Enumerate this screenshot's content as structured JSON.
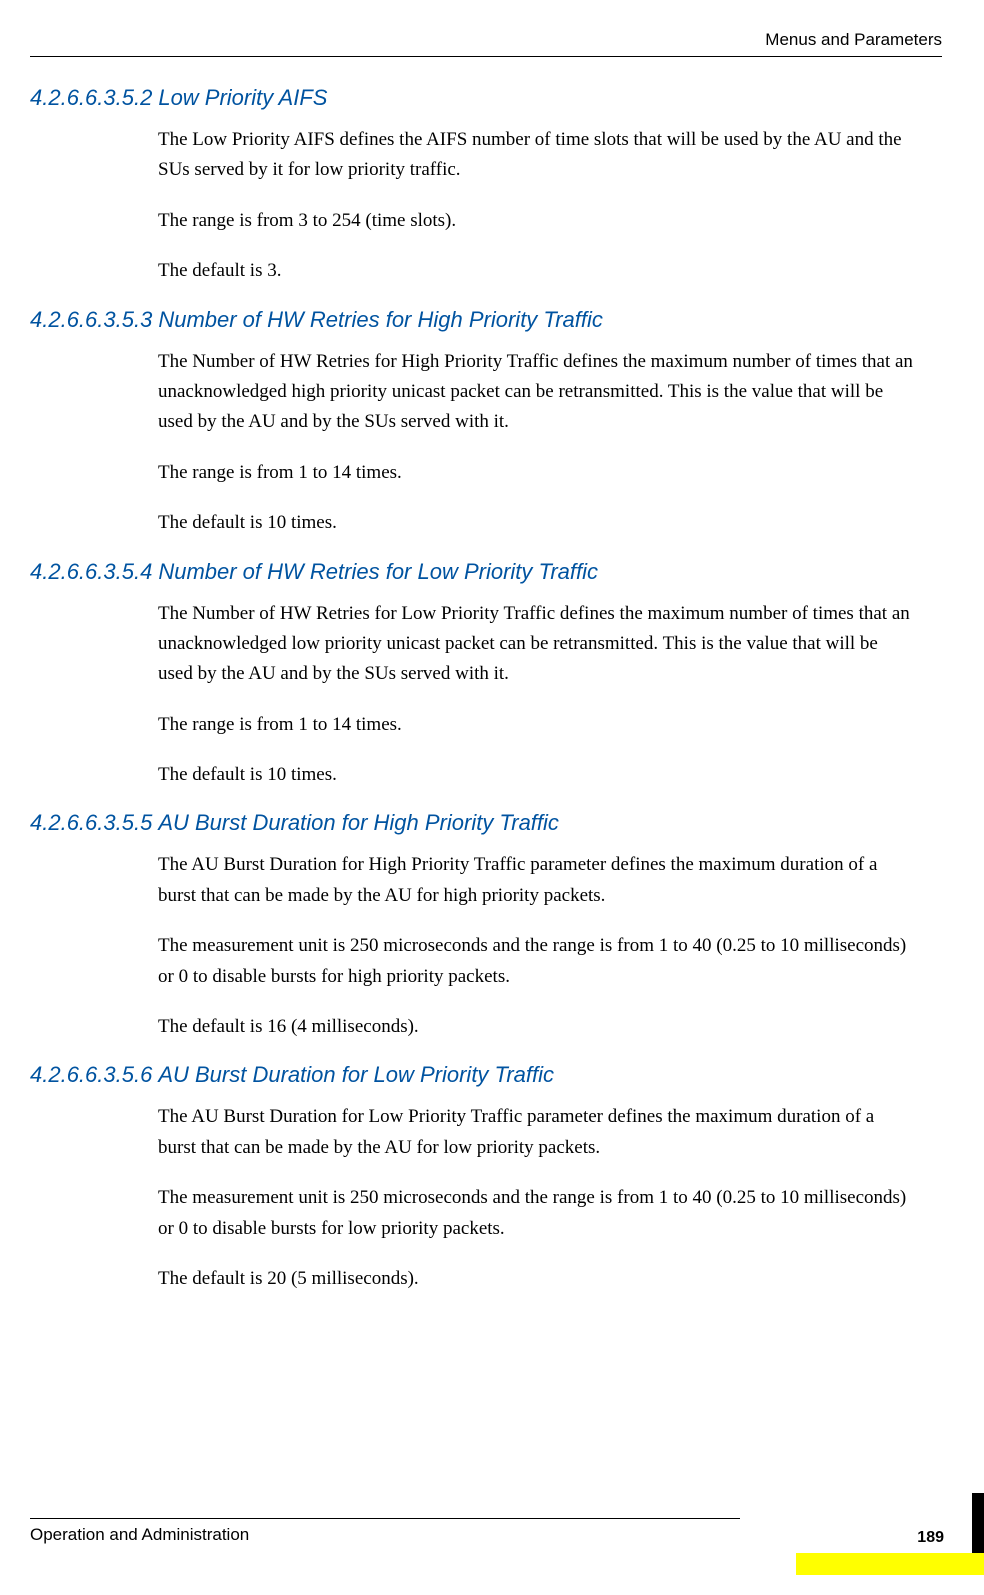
{
  "header": {
    "chapter": "Menus and Parameters"
  },
  "sections": [
    {
      "number": "4.2.6.6.3.5.2",
      "title": "Low Priority AIFS",
      "paragraphs": [
        "The Low Priority AIFS defines the AIFS number of time slots that will be used by the AU and the SUs served by it for low priority traffic.",
        "The range is from 3 to 254 (time slots).",
        "The default is 3."
      ]
    },
    {
      "number": "4.2.6.6.3.5.3",
      "title": "Number of HW Retries for High Priority Traffic",
      "paragraphs": [
        "The Number of HW Retries for High Priority Traffic defines the maximum number of times that an unacknowledged high priority unicast packet can be retransmitted. This is the value that will be used by the AU and by the SUs served with it.",
        "The range is from 1 to 14 times.",
        "The default is 10 times."
      ]
    },
    {
      "number": "4.2.6.6.3.5.4",
      "title": "Number of HW Retries for Low Priority Traffic",
      "paragraphs": [
        "The Number of HW Retries for Low Priority Traffic defines the maximum number of times that an unacknowledged low priority unicast packet can be retransmitted. This is the value that will be used by the AU and by the SUs served with it.",
        "The range is from 1 to 14 times.",
        "The default is 10 times."
      ]
    },
    {
      "number": "4.2.6.6.3.5.5",
      "title": "AU Burst Duration for High Priority Traffic",
      "paragraphs": [
        "The AU Burst Duration for High Priority Traffic parameter defines the maximum duration of a burst that can be made by the AU for high priority packets.",
        "The measurement unit is 250 microseconds and the range is from 1 to 40 (0.25 to 10 milliseconds) or 0 to disable bursts for high priority packets.",
        "The default is 16 (4 milliseconds)."
      ]
    },
    {
      "number": "4.2.6.6.3.5.6",
      "title": "AU Burst Duration for Low Priority Traffic",
      "paragraphs": [
        "The AU Burst Duration for Low Priority Traffic parameter defines the maximum duration of a burst that can be made by the AU for low priority packets.",
        "The measurement unit is 250 microseconds and the range is from 1 to 40 (0.25 to 10 milliseconds) or 0 to disable bursts for low priority packets.",
        "The default is 20 (5 milliseconds)."
      ]
    }
  ],
  "footer": {
    "text": "Operation and Administration",
    "page": "189"
  }
}
